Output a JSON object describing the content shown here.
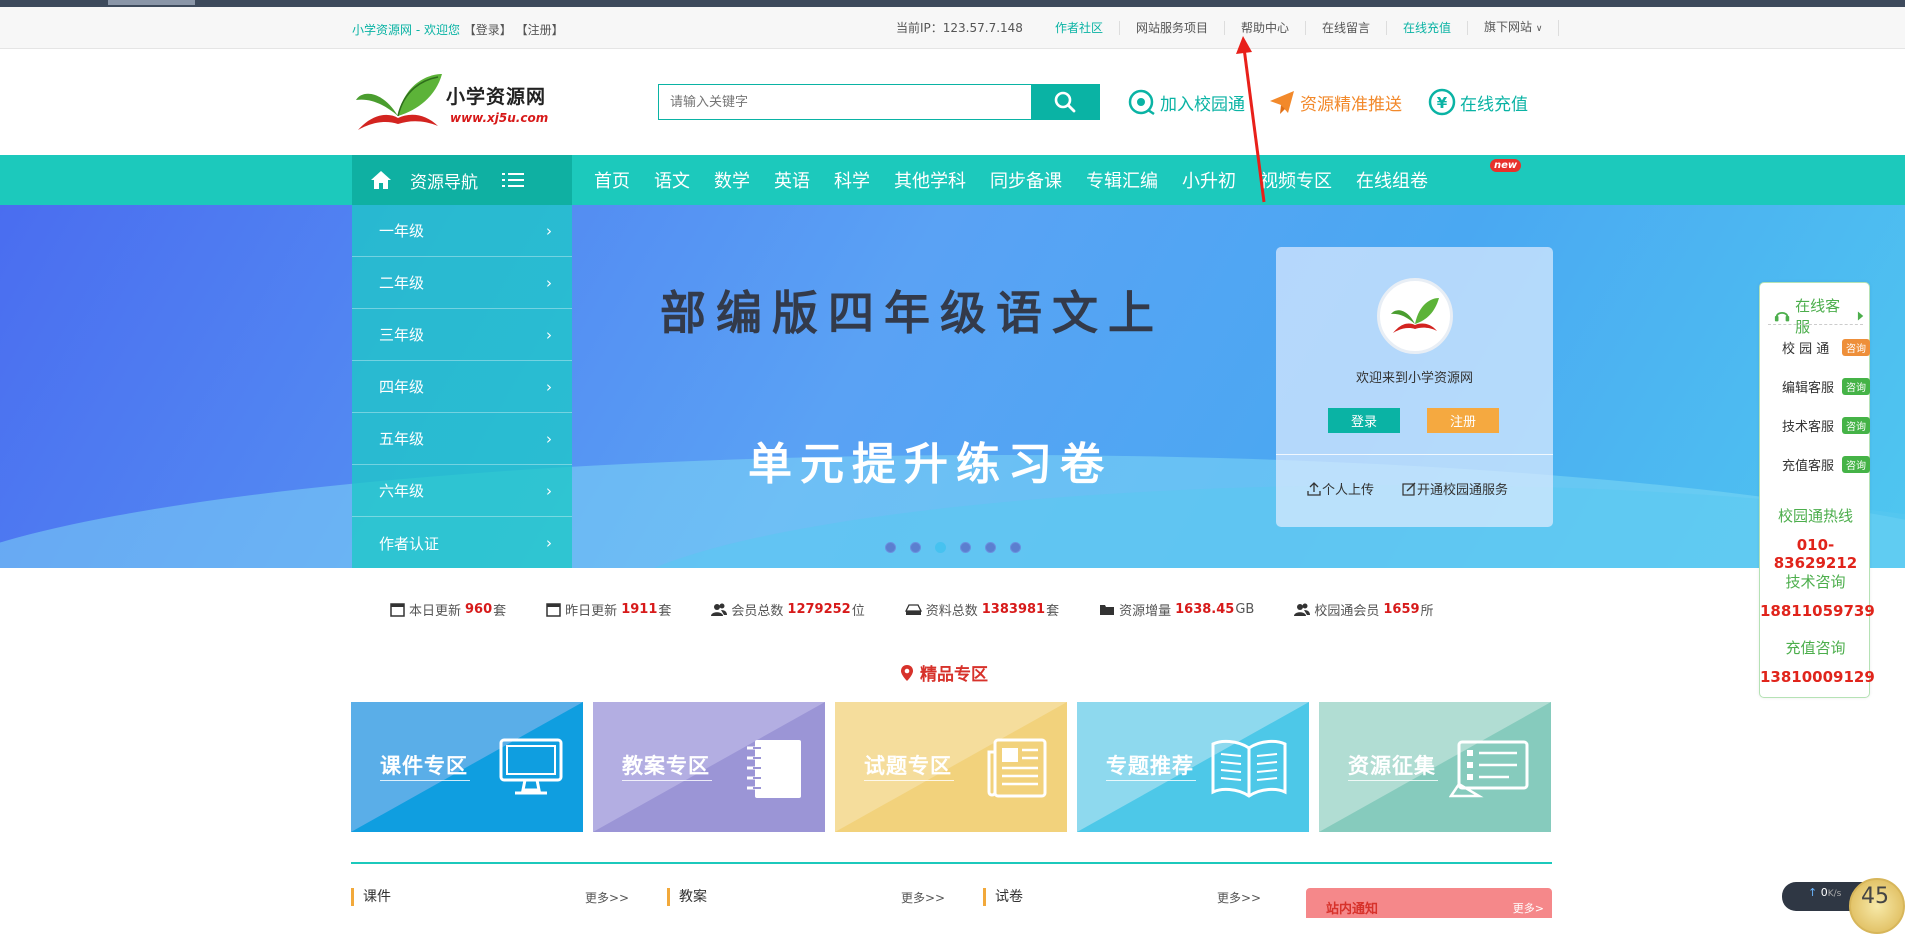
{
  "topbar": {
    "site_welcome": "小学资源网 - 欢迎您",
    "login_link": "【登录】",
    "register_link": "【注册】",
    "ip_label": "当前IP：123.57.7.148",
    "links": [
      "作者社区",
      "网站服务项目",
      "帮助中心",
      "在线留言",
      "在线充值",
      "旗下网站"
    ]
  },
  "header": {
    "logo_title": "小学资源网",
    "logo_url": "www.xj5u.com",
    "search_placeholder": "请输入关键字",
    "join_campus": "加入校园通",
    "precise_push": "资源精准推送",
    "online_recharge": "在线充值"
  },
  "nav": {
    "resource_nav": "资源导航",
    "items": [
      "首页",
      "语文",
      "数学",
      "英语",
      "科学",
      "其他学科",
      "同步备课",
      "专辑汇编",
      "小升初",
      "视频专区",
      "在线组卷"
    ],
    "new_badge": "new"
  },
  "grades": [
    "一年级",
    "二年级",
    "三年级",
    "四年级",
    "五年级",
    "六年级",
    "作者认证"
  ],
  "banner": {
    "line1": "部编版四年级语文上",
    "line2": "单元提升练习卷",
    "dots_count": 6,
    "active_dot": 2
  },
  "login_card": {
    "welcome": "欢迎来到小学资源网",
    "login_btn": "登录",
    "register_btn": "注册",
    "upload": "个人上传",
    "open_campus": "开通校园通服务"
  },
  "stats": [
    {
      "label": "本日更新",
      "value": "960",
      "unit": "套"
    },
    {
      "label": "昨日更新",
      "value": "1911",
      "unit": "套"
    },
    {
      "label": "会员总数",
      "value": "1279252",
      "unit": "位"
    },
    {
      "label": "资料总数",
      "value": "1383981",
      "unit": "套"
    },
    {
      "label": "资源增量",
      "value": "1638.45",
      "unit": "GB"
    },
    {
      "label": "校园通会员",
      "value": "1659",
      "unit": "所"
    }
  ],
  "featured": {
    "title": "精品专区",
    "tiles": [
      "课件专区",
      "教案专区",
      "试题专区",
      "专题推荐",
      "资源征集"
    ]
  },
  "sections": {
    "s1": "课件",
    "s2": "教案",
    "s3": "试卷",
    "more": "更多>>",
    "notice": "站内通知",
    "notice_more": "更多>"
  },
  "service": {
    "title": "在线客服",
    "rows": [
      {
        "name": "校 园 通",
        "tag": "咨询"
      },
      {
        "name": "编辑客服",
        "tag": "咨询"
      },
      {
        "name": "技术客服",
        "tag": "咨询"
      },
      {
        "name": "充值客服",
        "tag": "咨询"
      }
    ],
    "hotline_label": "校园通热线",
    "hotline": "010-83629212",
    "tech_label": "技术咨询",
    "tech_phone": "18811059739",
    "recharge_label": "充值咨询",
    "recharge_phone": "13810009129"
  },
  "speed_widget": {
    "rate": "0",
    "unit": "K/s",
    "percent": "45"
  },
  "colors": {
    "accent": "#1cc9bc",
    "accent_dark": "#0ab3a4",
    "red": "#d71a1a",
    "orange": "#f2892b"
  }
}
